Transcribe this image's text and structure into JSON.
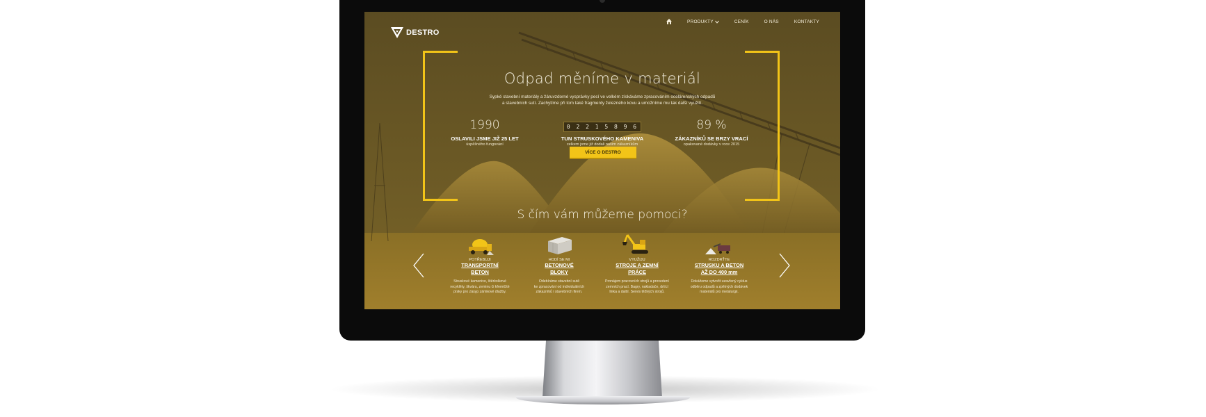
{
  "brand": {
    "name": "DESTRO"
  },
  "nav": {
    "items": [
      {
        "label": "PRODUKTY",
        "dropdown": true
      },
      {
        "label": "CENÍK"
      },
      {
        "label": "O NÁS"
      },
      {
        "label": "KONTAKTY"
      }
    ]
  },
  "hero": {
    "title": "Odpad měníme v materiál",
    "subtitle_line1": "Sypké stavební materiály a žáruvzdorné vysprávky pecí ve velkém získáváme zpracováním ocelárenských odpadů",
    "subtitle_line2": "a stavebních sutí. Zachytíme při tom také fragmenty železného kovu a umožníme mu tak další využití.",
    "stats": [
      {
        "number": "1990",
        "label": "OSLAVILI JSME JIŽ 25 LET",
        "desc": "úspěšného fungování"
      },
      {
        "number": "0 2 2 1 5 8 9 6",
        "label": "TUN STRUSKOVÉHO KAMENIVA",
        "desc": "celkem jsme již dodali našim zákazníkům"
      },
      {
        "number": "89 %",
        "label": "ZÁKAZNÍKŮ SE BRZY VRACÍ",
        "desc": "opakované dodávky v roce 2015"
      }
    ],
    "cta_label": "VÍCE O DESTRO"
  },
  "services": {
    "title": "S čím vám můžeme pomoci?",
    "items": [
      {
        "pre": "POTŘEBUJI",
        "name1": "TRANSPORTNÍ",
        "name2": "BETON",
        "desc1": "Struskové kamenivo, štěrkolkové",
        "desc2": "recyklěty, škváru, zeminu či křemičité",
        "desc3": "písky pro zásyp zámkové dlažby.",
        "icon": "concrete-mixer-icon"
      },
      {
        "pre": "HODÍ SE MI",
        "name1": "BETONOVÉ",
        "name2": "BLOKY",
        "desc1": "Odebíráme stavební sutě",
        "desc2": "ke zpracování od individuálních",
        "desc3": "zákazníků i stavebních firem.",
        "icon": "concrete-blocks-icon"
      },
      {
        "pre": "VYUŽIJU",
        "name1": "STROJE A ZEMNÍ",
        "name2": "PRÁCE",
        "desc1": "Pronájem pracovních strojů a provedení",
        "desc2": "zemních prací. Bagry, nakladače, drtící",
        "desc3": "linka a další. Servis těžkých strojů.",
        "icon": "excavator-icon"
      },
      {
        "pre": "ROZDRŤTE",
        "name1": "STRUSKU A BETON",
        "name2": "AŽ DO 400 mm",
        "desc1": "Dokážeme vytvořit uzavřený cyklus",
        "desc2": "odběru odpadů a zpětných dodávek",
        "desc3": "materiálů pro metalurgii.",
        "icon": "crusher-icon"
      }
    ]
  },
  "colors": {
    "accent": "#f2c418",
    "overlay": "#5a4a1e",
    "text": "#f4efdf"
  }
}
